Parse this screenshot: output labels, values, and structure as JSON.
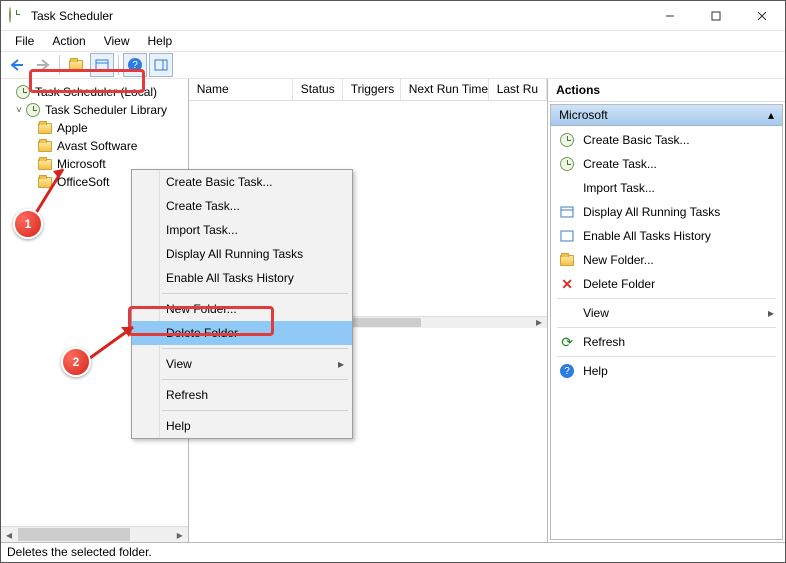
{
  "window": {
    "title": "Task Scheduler"
  },
  "menu": {
    "file": "File",
    "action": "Action",
    "view": "View",
    "help": "Help"
  },
  "tree": {
    "root": "Task Scheduler (Local)",
    "library": "Task Scheduler Library",
    "items": [
      "Apple",
      "Avast Software",
      "Microsoft",
      "OfficeSoft"
    ]
  },
  "list": {
    "columns": [
      "Name",
      "Status",
      "Triggers",
      "Next Run Time",
      "Last Ru"
    ]
  },
  "context_menu": {
    "items": [
      "Create Basic Task...",
      "Create Task...",
      "Import Task...",
      "Display All Running Tasks",
      "Enable All Tasks History",
      "New Folder...",
      "Delete Folder",
      "View",
      "Refresh",
      "Help"
    ],
    "highlighted": "Delete Folder"
  },
  "actions": {
    "title": "Actions",
    "header": "Microsoft",
    "items": [
      "Create Basic Task...",
      "Create Task...",
      "Import Task...",
      "Display All Running Tasks",
      "Enable All Tasks History",
      "New Folder...",
      "Delete Folder",
      "View",
      "Refresh",
      "Help"
    ]
  },
  "callouts": {
    "one": "1",
    "two": "2"
  },
  "status": "Deletes the selected folder."
}
